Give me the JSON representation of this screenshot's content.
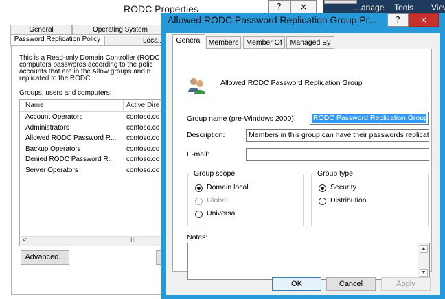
{
  "background_window": {
    "title": "RODC Properties",
    "help_glyph": "?",
    "close_glyph": "×",
    "menu": [
      "...anage",
      "Tools",
      "View"
    ],
    "tabs": [
      "General",
      "Operating System",
      "Password Replication Policy",
      "Loca..."
    ],
    "description": "This is a Read-only Domain Controller (RODC... computers passwords according to the policy... accounts that are in the Allow groups and no... replicated to the RODC.",
    "description_lines": [
      "This is a Read-only Domain Controller (RODC",
      "computers passwords according to the polic",
      "accounts that are in the Allow groups and n",
      "replicated to the RODC."
    ],
    "groups_label": "Groups, users and computers:",
    "list_headers": [
      "Name",
      "Active Dire"
    ],
    "list_rows": [
      {
        "name": "Account Operators",
        "dir": "contoso.co"
      },
      {
        "name": "Administrators",
        "dir": "contoso.co"
      },
      {
        "name": "Allowed RODC Password R...",
        "dir": "contoso.co"
      },
      {
        "name": "Backup Operators",
        "dir": "contoso.co"
      },
      {
        "name": "Denied RODC Password R...",
        "dir": "contoso.co"
      },
      {
        "name": "Server Operators",
        "dir": "contoso.co"
      }
    ],
    "scroll_left": "<",
    "scroll_thumb": "III",
    "advanced_button": "Advanced...",
    "highlight_color": "#f4f000"
  },
  "dialog": {
    "title": "Allowed RODC Password Replication Group Pr...",
    "help_glyph": "?",
    "close_glyph": "×",
    "tabs": [
      "General",
      "Members",
      "Member Of",
      "Managed By"
    ],
    "active_tab": "General",
    "group_display_name": "Allowed RODC Password Replication Group",
    "prewin_label": "Group name (pre-Windows 2000):",
    "prewin_value": "RODC Password Replication Group",
    "description_label": "Description:",
    "description_value": "Members in this group can have their passwords replicat",
    "email_label": "E-mail:",
    "email_value": "",
    "scope_title": "Group scope",
    "scope_options": [
      "Domain local",
      "Global",
      "Universal"
    ],
    "scope_selected": "Domain local",
    "type_title": "Group type",
    "type_options": [
      "Security",
      "Distribution"
    ],
    "type_selected": "Security",
    "notes_label": "Notes:",
    "notes_value": "",
    "ok_label": "OK",
    "cancel_label": "Cancel",
    "apply_label": "Apply"
  },
  "colors": {
    "dialog_border": "#2798d8",
    "close_button": "#c7312b",
    "selection": "#3399ff",
    "menubar": "#1e3a5c"
  }
}
